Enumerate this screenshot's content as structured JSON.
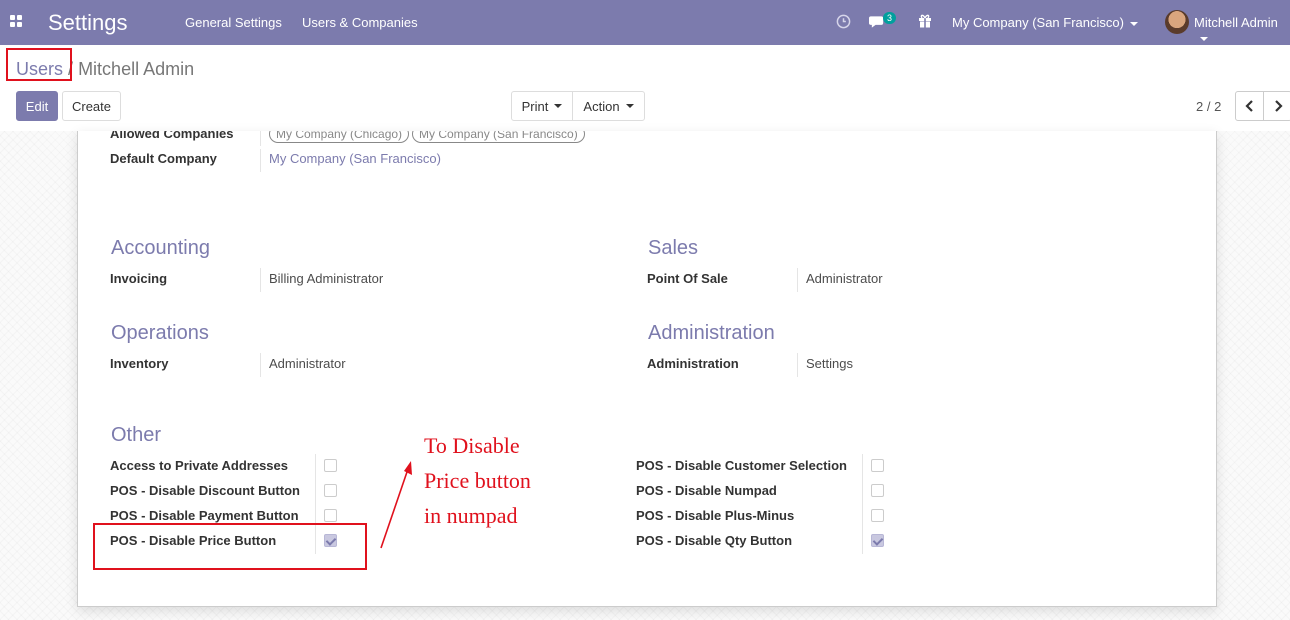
{
  "navbar": {
    "app_title": "Settings",
    "menu": [
      "General Settings",
      "Users & Companies"
    ],
    "messages_badge": "3",
    "company": "My Company (San Francisco)",
    "user": "Mitchell Admin"
  },
  "breadcrumb": {
    "parent": "Users",
    "separator": "/",
    "current": "Mitchell Admin"
  },
  "toolbar": {
    "edit": "Edit",
    "create": "Create",
    "print": "Print",
    "action": "Action",
    "pager": "2 / 2"
  },
  "form": {
    "allowed_companies_label": "Allowed Companies",
    "allowed_companies": [
      "My Company (Chicago)",
      "My Company (San Francisco)"
    ],
    "default_company_label": "Default Company",
    "default_company": "My Company (San Francisco)",
    "sections": {
      "accounting": {
        "title": "Accounting",
        "label": "Invoicing",
        "value": "Billing Administrator"
      },
      "sales": {
        "title": "Sales",
        "label": "Point Of Sale",
        "value": "Administrator"
      },
      "operations": {
        "title": "Operations",
        "label": "Inventory",
        "value": "Administrator"
      },
      "administration": {
        "title": "Administration",
        "label": "Administration",
        "value": "Settings"
      }
    },
    "other_title": "Other",
    "other_left": [
      {
        "label": "Access to Private Addresses",
        "checked": false
      },
      {
        "label": "POS - Disable Discount Button",
        "checked": false
      },
      {
        "label": "POS - Disable Payment Button",
        "checked": false
      },
      {
        "label": "POS - Disable Price Button",
        "checked": true
      }
    ],
    "other_right": [
      {
        "label": "POS - Disable Customer Selection",
        "checked": false
      },
      {
        "label": "POS - Disable Numpad",
        "checked": false
      },
      {
        "label": "POS - Disable Plus-Minus",
        "checked": false
      },
      {
        "label": "POS - Disable Qty Button",
        "checked": true
      }
    ]
  },
  "annotation": {
    "lines": [
      "To Disable",
      "Price button",
      "in numpad"
    ],
    "color": "#e0111d"
  },
  "colors": {
    "brand": "#7c7bad",
    "highlight": "#e0111d"
  }
}
